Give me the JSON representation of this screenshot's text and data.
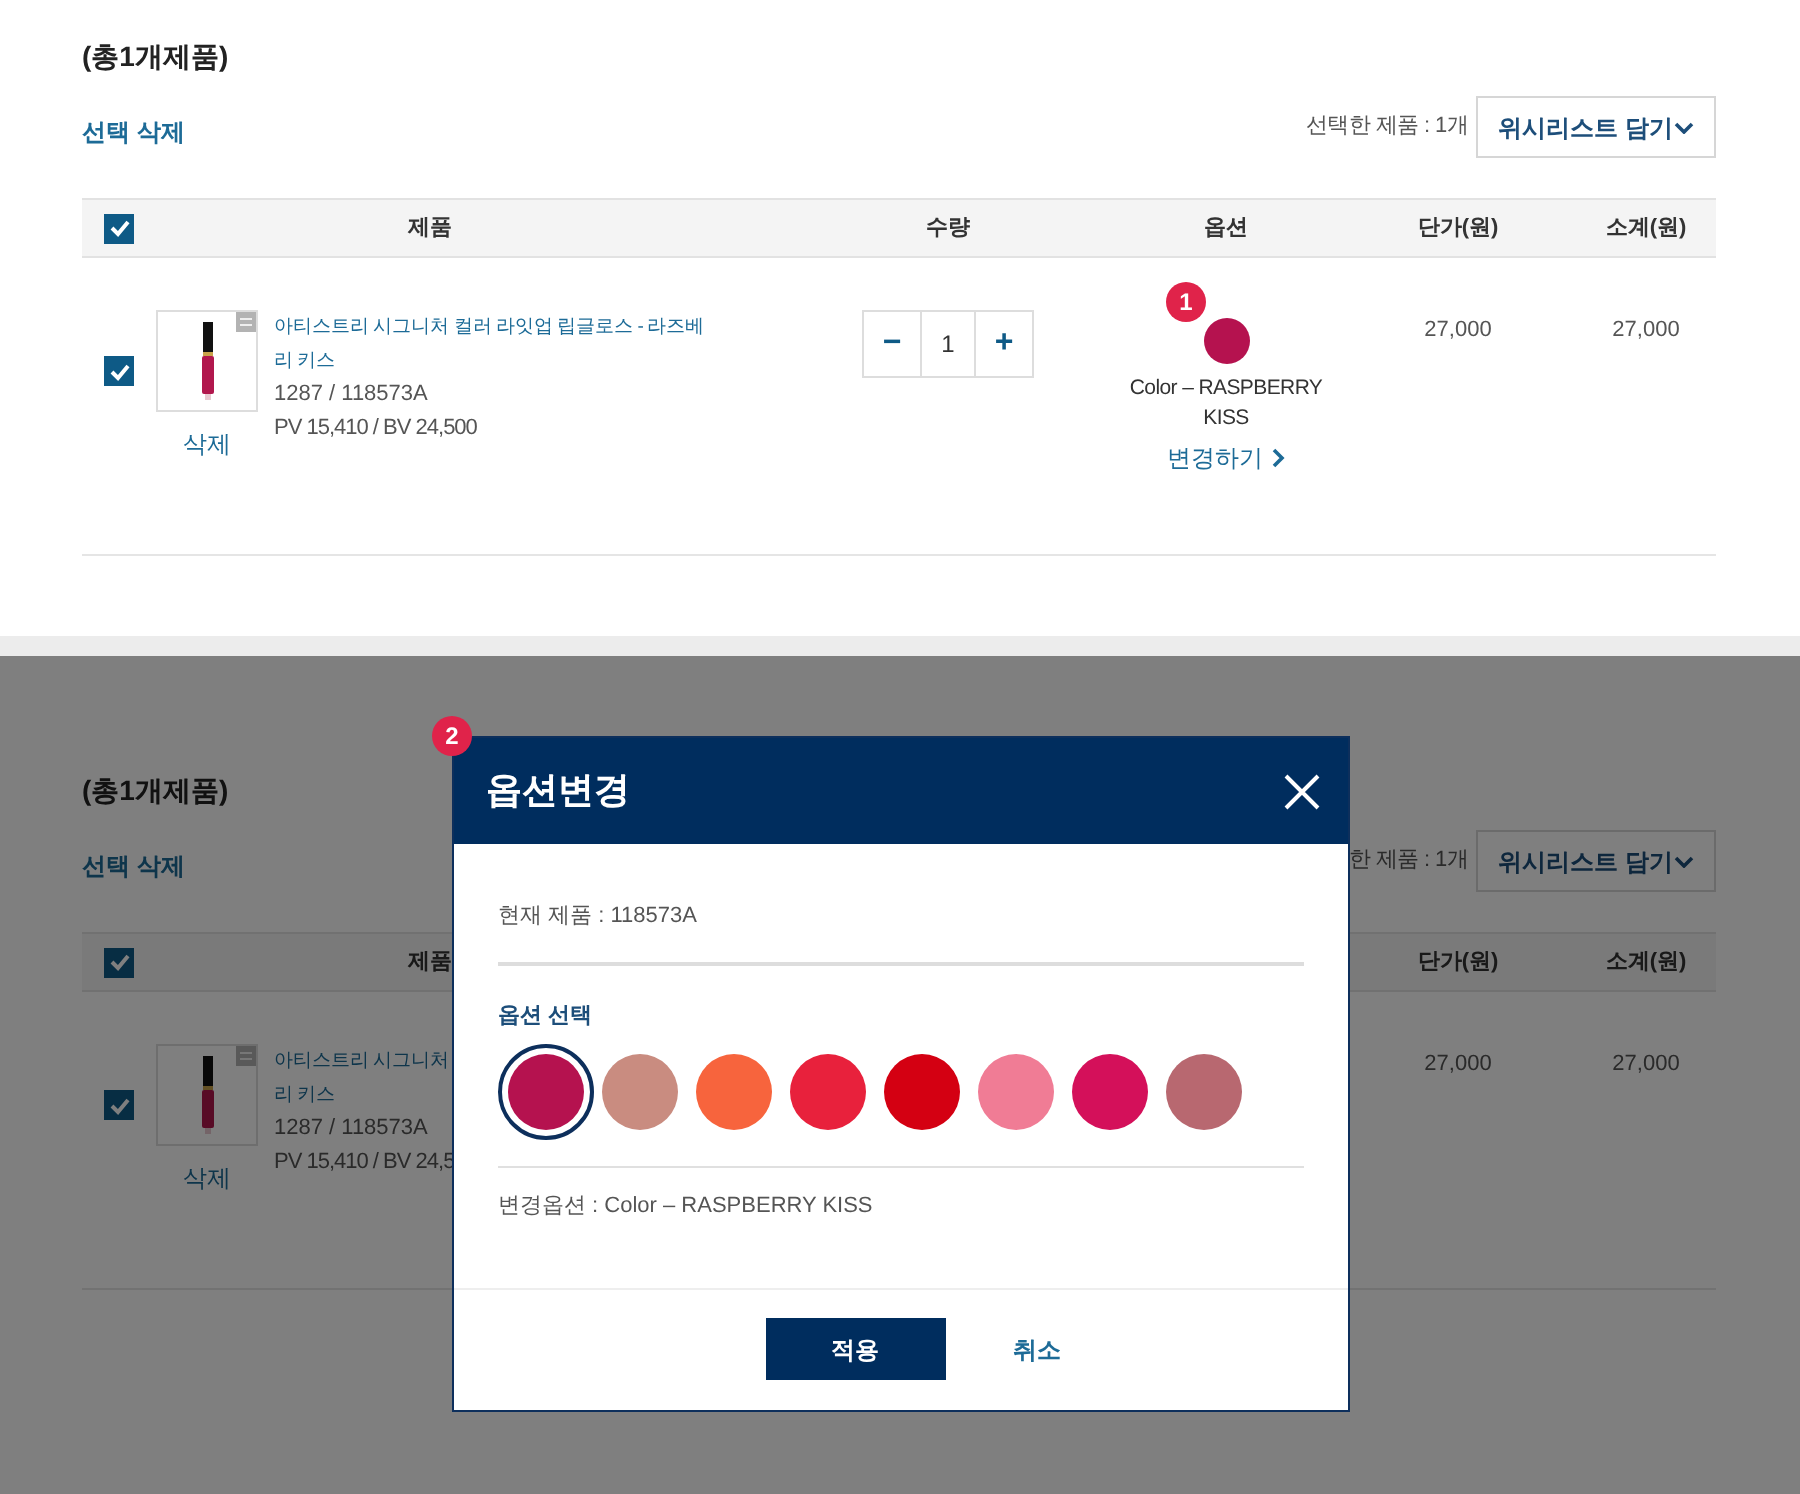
{
  "cart": {
    "title": "(총1개제품)",
    "delete_selected": "선택 삭제",
    "selected_count": "선택한 제품 : 1개",
    "wishlist_select": "위시리스트 담기",
    "select_all_checked": true,
    "columns": {
      "product": "제품",
      "quantity": "수량",
      "option": "옵션",
      "unit_price": "단가(원)",
      "subtotal": "소계(원)"
    },
    "items": [
      {
        "checked": true,
        "name_lines": [
          "아티스트리 시그니처 컬러 라잇업 립글로스 - 라즈베",
          "리 키스"
        ],
        "codes": "1287 / 118573A",
        "points": "PV 15,410 / BV 24,500",
        "delete": "삭제",
        "decrement": "−",
        "quantity": "1",
        "increment": "+",
        "option": {
          "badge": "1",
          "color": "#b5124f",
          "text": "Color – RASPBERRY KISS",
          "change_link": "변경하기"
        },
        "unit_price": "27,000",
        "subtotal": "27,000"
      }
    ]
  },
  "dimmed_cart": {
    "title": "(총1개제품)",
    "delete_selected": "선택 삭제",
    "selected_count": "한 제품 : 1개",
    "wishlist_select": "위시리스트 담기",
    "select_all_checked": true,
    "columns": {
      "product": "제품",
      "unit_price": "단가(원)",
      "subtotal": "소계(원)"
    },
    "items": [
      {
        "checked": true,
        "name_lines": [
          "아티스트리 시그니처",
          "리 키스"
        ],
        "codes": "1287 / 118573A",
        "points": "PV 15,410 / BV 24,5",
        "delete": "삭제",
        "unit_price": "27,000",
        "subtotal": "27,000"
      }
    ]
  },
  "modal": {
    "badge": "2",
    "title": "옵션변경",
    "current_product": "현재 제품 : 118573A",
    "option_label": "옵션 선택",
    "swatches": [
      {
        "color": "#b5124f",
        "selected": true
      },
      {
        "color": "#c98c80",
        "selected": false
      },
      {
        "color": "#f7643d",
        "selected": false
      },
      {
        "color": "#e8213c",
        "selected": false
      },
      {
        "color": "#d40012",
        "selected": false
      },
      {
        "color": "#f07c95",
        "selected": false
      },
      {
        "color": "#d4105a",
        "selected": false
      },
      {
        "color": "#b86870",
        "selected": false
      }
    ],
    "changed_option": "변경옵션 : Color – RASPBERRY KISS",
    "apply": "적용",
    "cancel": "취소"
  }
}
